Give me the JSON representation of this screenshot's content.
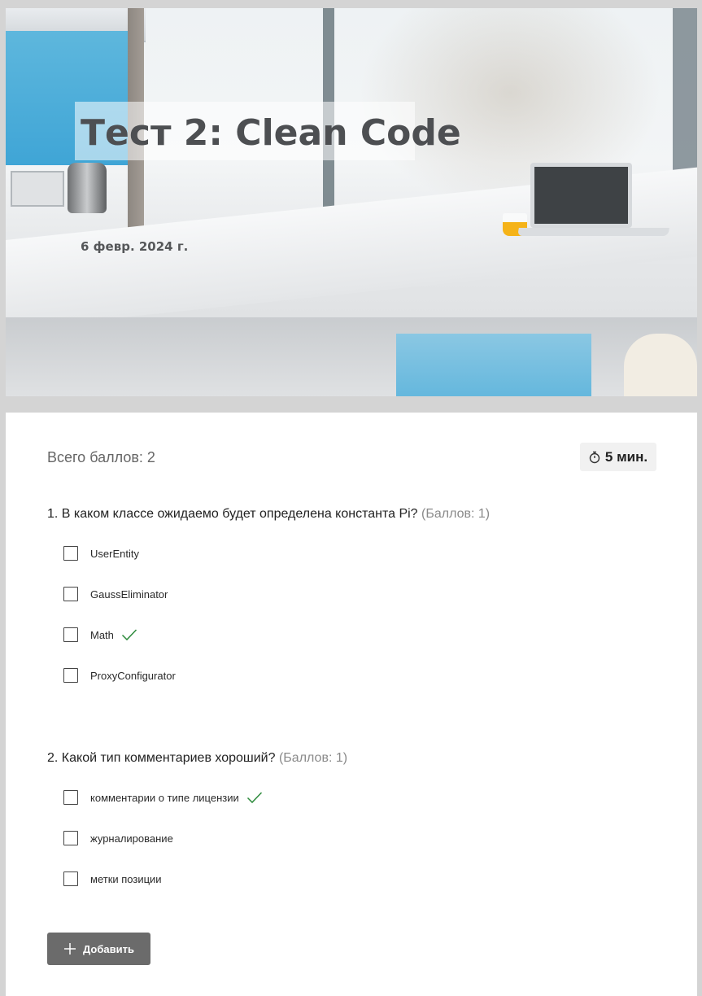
{
  "header": {
    "title": "Тест 2: Clean Code",
    "date": "6 февр. 2024 г."
  },
  "form": {
    "total_points": "Всего баллов: 2",
    "timer": {
      "icon": "stopwatch-icon",
      "label": "5 мин."
    },
    "questions": [
      {
        "text": "1. В каком классе ожидаемо будет определена константа Pi?",
        "points": "(Баллов: 1)",
        "options": [
          {
            "label": "UserEntity",
            "correct": false
          },
          {
            "label": "GaussEliminator",
            "correct": false
          },
          {
            "label": "Math",
            "correct": true
          },
          {
            "label": "ProxyConfigurator",
            "correct": false
          }
        ]
      },
      {
        "text": "2. Какой тип комментариев хороший?",
        "points": "(Баллов: 1)",
        "options": [
          {
            "label": "комментарии о типе лицензии",
            "correct": true
          },
          {
            "label": "журналирование",
            "correct": false
          },
          {
            "label": "метки позиции",
            "correct": false
          }
        ]
      }
    ],
    "add_button": {
      "icon": "plus-icon",
      "label": "Добавить"
    }
  },
  "colors": {
    "correct_check": "#2e8b3d",
    "button_bg": "#6b6b6b",
    "page_bg": "#d4d4d4"
  }
}
